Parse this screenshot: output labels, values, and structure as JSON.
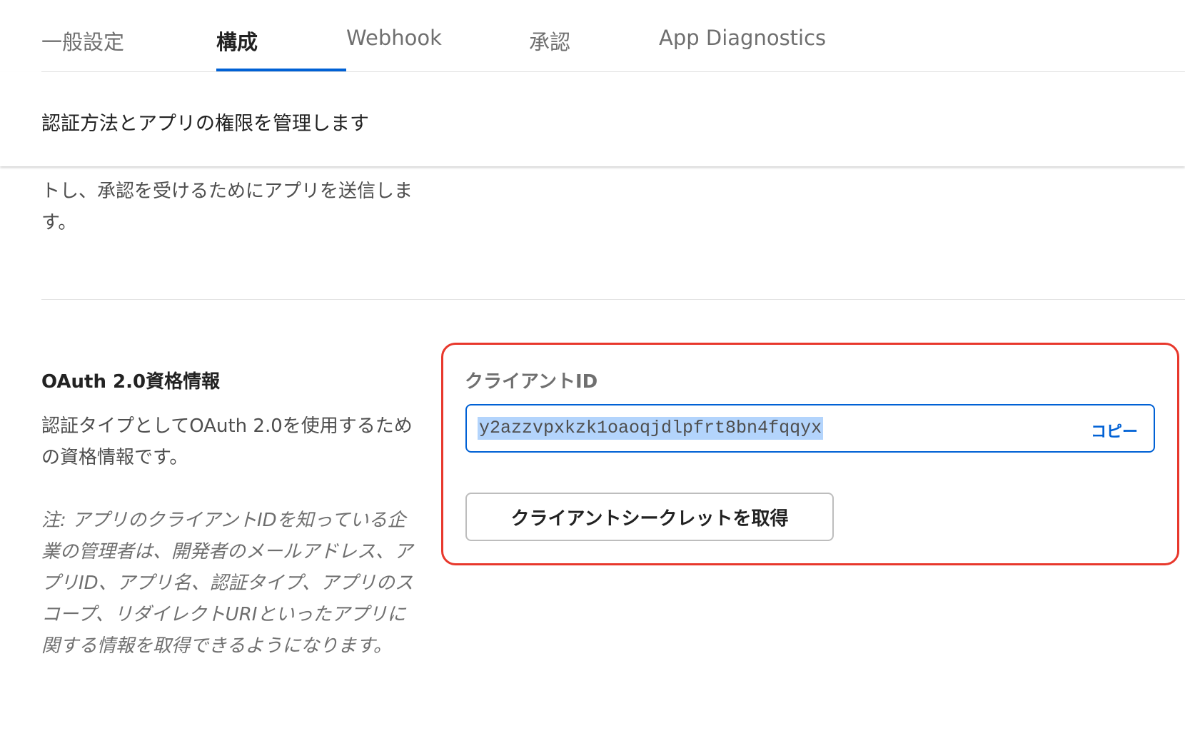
{
  "tabs": [
    {
      "label": "一般設定",
      "active": false
    },
    {
      "label": "構成",
      "active": true
    },
    {
      "label": "Webhook",
      "active": false
    },
    {
      "label": "承認",
      "active": false
    },
    {
      "label": "App Diagnostics",
      "active": false
    }
  ],
  "header": {
    "subtitle": "認証方法とアプリの権限を管理します"
  },
  "previous_section": {
    "partial_text": "トし、承認を受けるためにアプリを送信します。"
  },
  "oauth_section": {
    "title": "OAuth 2.0資格情報",
    "description": "認証タイプとしてOAuth 2.0を使用するための資格情報です。",
    "note": "注: アプリのクライアントIDを知っている企業の管理者は、開発者のメールアドレス、アプリID、アプリ名、認証タイプ、アプリのスコープ、リダイレクトURIといったアプリに関する情報を取得できるようになります。",
    "client_id_label": "クライアントID",
    "client_id_value": "y2azzvpxkzk1oaoqjdlpfrt8bn4fqqyx",
    "copy_label": "コピー",
    "secret_button_label": "クライアントシークレットを取得"
  },
  "colors": {
    "accent": "#0061d5",
    "highlight_border": "#e8382c",
    "selection": "#b3d4fc"
  }
}
